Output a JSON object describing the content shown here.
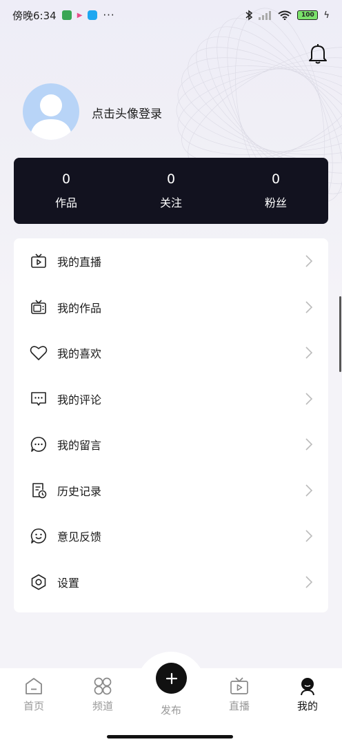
{
  "status_bar": {
    "time": "傍晚6:34",
    "battery": "100",
    "more": "···"
  },
  "header": {
    "login_prompt": "点击头像登录"
  },
  "stats": [
    {
      "value": "0",
      "label": "作品"
    },
    {
      "value": "0",
      "label": "关注"
    },
    {
      "value": "0",
      "label": "粉丝"
    }
  ],
  "menu": {
    "items": [
      {
        "label": "我的直播",
        "icon": "tv-play-icon"
      },
      {
        "label": "我的作品",
        "icon": "tv-icon"
      },
      {
        "label": "我的喜欢",
        "icon": "heart-icon"
      },
      {
        "label": "我的评论",
        "icon": "comment-icon"
      },
      {
        "label": "我的留言",
        "icon": "message-icon"
      },
      {
        "label": "历史记录",
        "icon": "history-icon"
      },
      {
        "label": "意见反馈",
        "icon": "smile-icon"
      },
      {
        "label": "设置",
        "icon": "settings-hexagon-icon"
      }
    ]
  },
  "tabbar": {
    "items": [
      {
        "label": "首页",
        "icon": "home-icon"
      },
      {
        "label": "频道",
        "icon": "channels-icon"
      },
      {
        "label": "发布",
        "icon": "plus-icon"
      },
      {
        "label": "直播",
        "icon": "live-tv-icon"
      },
      {
        "label": "我的",
        "icon": "profile-icon",
        "active": true
      }
    ]
  },
  "colors": {
    "stats_bg": "#12121f",
    "avatar_bg": "#b8d4f7",
    "page_bg": "#f4f3f8",
    "tab_active": "#111111",
    "tab_inactive": "#999999"
  }
}
